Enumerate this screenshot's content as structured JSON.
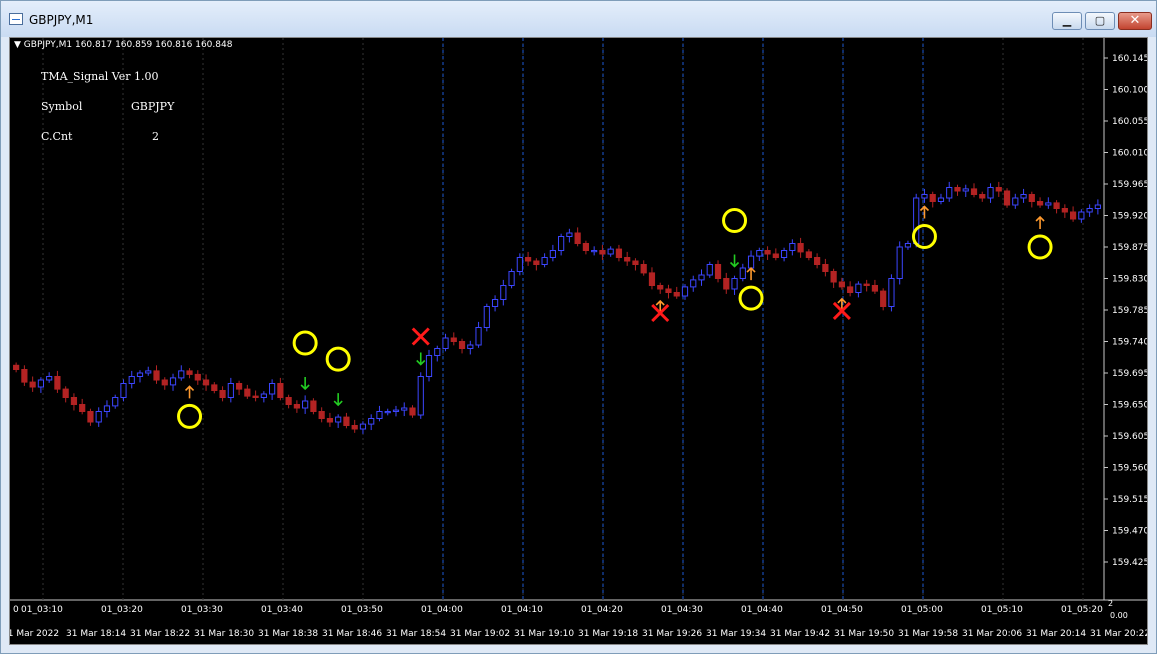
{
  "window": {
    "title": "GBPJPY,M1"
  },
  "chart_header": {
    "symbol_label": "GBPJPY,M1",
    "ohlc": "160.817 160.859 160.816 160.848"
  },
  "info_panel": {
    "title": "TMA_Signal  Ver 1.00",
    "symbol_label": "Symbol",
    "symbol_value": "GBPJPY",
    "count_label": "C.Cnt",
    "count_value": "2"
  },
  "colors": {
    "background": "#000000",
    "bull": "#3c46ff",
    "bear": "#b32323",
    "grid": "#333333",
    "vline": "#1d5ad6",
    "circle": "#ffff00",
    "cross": "#ff1a1a",
    "up_arrow": "#ff9a2e",
    "down_arrow": "#22cc22"
  },
  "chart_data": {
    "type": "candlestick",
    "y_ticks": [
      160.145,
      160.1,
      160.055,
      160.01,
      159.965,
      159.92,
      159.875,
      159.83,
      159.785,
      159.74,
      159.695,
      159.65,
      159.605,
      159.56,
      159.515,
      159.47,
      159.425
    ],
    "ylim": [
      159.425,
      160.145
    ],
    "lower_axis": {
      "left": "0",
      "right_top": "2",
      "right_bottom": "0.00"
    },
    "top_time_labels": [
      "01_03:10",
      "01_03:20",
      "01_03:30",
      "01_03:40",
      "01_03:50",
      "01_04:00",
      "01_04:10",
      "01_04:20",
      "01_04:30",
      "01_04:40",
      "01_04:50",
      "01_05:00",
      "01_05:10",
      "01_05:20"
    ],
    "bottom_time_labels": [
      "31 Mar 2022",
      "31 Mar 18:14",
      "31 Mar 18:22",
      "31 Mar 18:30",
      "31 Mar 18:38",
      "31 Mar 18:46",
      "31 Mar 18:54",
      "31 Mar 19:02",
      "31 Mar 19:10",
      "31 Mar 19:18",
      "31 Mar 19:26",
      "31 Mar 19:34",
      "31 Mar 19:42",
      "31 Mar 19:50",
      "31 Mar 19:58",
      "31 Mar 20:06",
      "31 Mar 20:14",
      "31 Mar 20:22"
    ],
    "closes": [
      159.7,
      159.682,
      159.675,
      159.685,
      159.69,
      159.672,
      159.66,
      159.65,
      159.64,
      159.625,
      159.64,
      159.648,
      159.66,
      159.68,
      159.69,
      159.695,
      159.698,
      159.685,
      159.678,
      159.688,
      159.698,
      159.693,
      159.685,
      159.678,
      159.67,
      159.66,
      159.68,
      159.672,
      159.662,
      159.66,
      159.665,
      159.68,
      159.66,
      159.65,
      159.645,
      159.655,
      159.64,
      159.63,
      159.625,
      159.632,
      159.62,
      159.615,
      159.622,
      159.63,
      159.64,
      159.64,
      159.642,
      159.645,
      159.635,
      159.69,
      159.72,
      159.73,
      159.745,
      159.74,
      159.73,
      159.735,
      159.76,
      159.79,
      159.8,
      159.82,
      159.84,
      159.86,
      159.855,
      159.85,
      159.86,
      159.87,
      159.89,
      159.895,
      159.88,
      159.87,
      159.87,
      159.865,
      159.872,
      159.86,
      159.855,
      159.85,
      159.838,
      159.82,
      159.815,
      159.81,
      159.805,
      159.818,
      159.828,
      159.835,
      159.85,
      159.83,
      159.815,
      159.83,
      159.845,
      159.862,
      159.87,
      159.865,
      159.86,
      159.87,
      159.88,
      159.868,
      159.86,
      159.85,
      159.84,
      159.825,
      159.818,
      159.81,
      159.822,
      159.82,
      159.812,
      159.79,
      159.83,
      159.875,
      159.88,
      159.945,
      159.95,
      159.94,
      159.945,
      159.96,
      159.955,
      159.958,
      159.95,
      159.945,
      159.96,
      159.955,
      159.935,
      159.945,
      159.95,
      159.94,
      159.935,
      159.938,
      159.93,
      159.925,
      159.915,
      159.925,
      159.93,
      159.935
    ]
  },
  "signals": [
    {
      "type": "up-arrow",
      "bar": 21
    },
    {
      "type": "circle",
      "bar": 21
    },
    {
      "type": "circle",
      "bar": 35
    },
    {
      "type": "down-arrow",
      "bar": 35
    },
    {
      "type": "circle",
      "bar": 39
    },
    {
      "type": "down-arrow",
      "bar": 39
    },
    {
      "type": "cross",
      "bar": 49
    },
    {
      "type": "down-arrow",
      "bar": 49
    },
    {
      "type": "up-arrow",
      "bar": 78
    },
    {
      "type": "cross",
      "bar": 78
    },
    {
      "type": "circle",
      "bar": 87
    },
    {
      "type": "down-arrow",
      "bar": 87
    },
    {
      "type": "up-arrow",
      "bar": 89
    },
    {
      "type": "circle",
      "bar": 89
    },
    {
      "type": "up-arrow",
      "bar": 100
    },
    {
      "type": "cross",
      "bar": 100
    },
    {
      "type": "up-arrow",
      "bar": 110
    },
    {
      "type": "circle",
      "bar": 110
    },
    {
      "type": "up-arrow",
      "bar": 124
    },
    {
      "type": "circle",
      "bar": 124
    }
  ]
}
